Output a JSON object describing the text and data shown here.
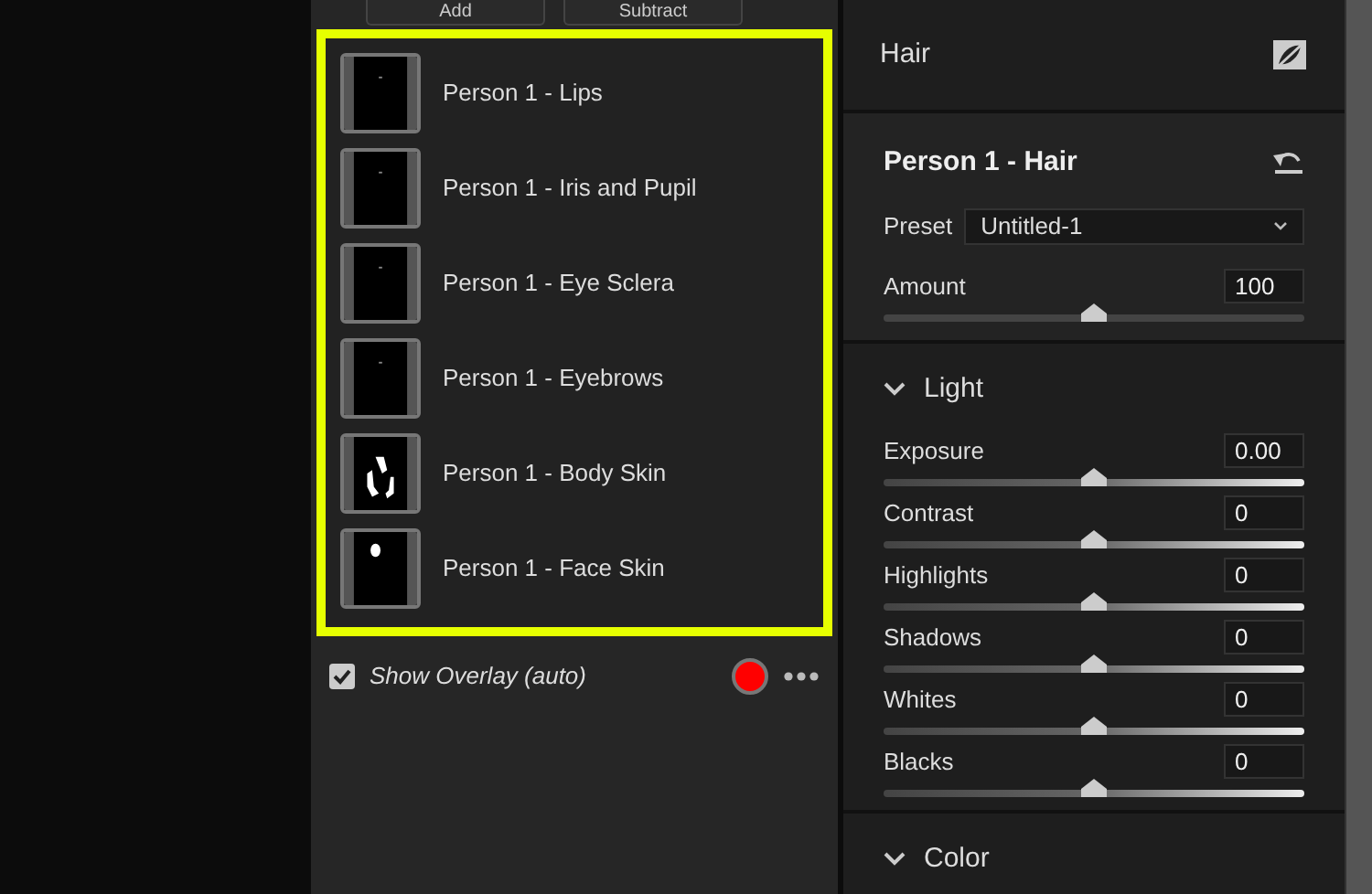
{
  "mask_panel": {
    "buttons": [
      "Add",
      "Subtract"
    ],
    "masks": [
      {
        "label": "Person 1 - Lips",
        "kind": "dot"
      },
      {
        "label": "Person 1 - Iris and Pupil",
        "kind": "dot"
      },
      {
        "label": "Person 1 - Eye Sclera",
        "kind": "dot"
      },
      {
        "label": "Person 1 - Eyebrows",
        "kind": "dot"
      },
      {
        "label": "Person 1 - Body Skin",
        "kind": "body"
      },
      {
        "label": "Person 1 - Face Skin",
        "kind": "face"
      }
    ],
    "show_overlay": {
      "label": "Show Overlay (auto)",
      "checked": true
    },
    "overlay_color": {
      "color": "#ff0000"
    }
  },
  "adjust_panel": {
    "title": "Hair",
    "mask_title": "Person 1 - Hair",
    "preset": {
      "label": "Preset",
      "value": "Untitled-1"
    },
    "amount": {
      "label": "Amount",
      "value": "100",
      "level": 0.5
    },
    "sections": [
      {
        "title": "Light",
        "expanded": true,
        "sliders": [
          {
            "label": "Exposure",
            "value": "0.00",
            "level": 0.5
          },
          {
            "label": "Contrast",
            "value": "0",
            "level": 0.5
          },
          {
            "label": "Highlights",
            "value": "0",
            "level": 0.5
          },
          {
            "label": "Shadows",
            "value": "0",
            "level": 0.5
          },
          {
            "label": "Whites",
            "value": "0",
            "level": 0.5
          },
          {
            "label": "Blacks",
            "value": "0",
            "level": 0.5
          }
        ]
      },
      {
        "title": "Color",
        "expanded": true
      }
    ]
  }
}
